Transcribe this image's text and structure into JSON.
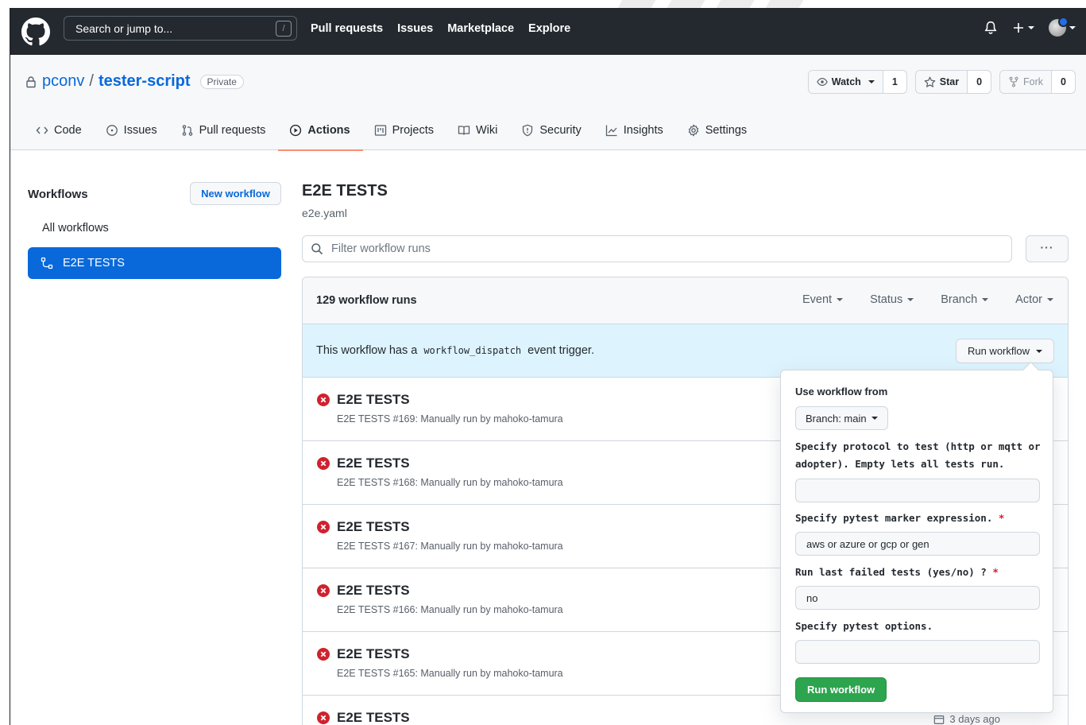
{
  "header": {
    "search_placeholder": "Search or jump to...",
    "slash_key": "/",
    "nav": [
      "Pull requests",
      "Issues",
      "Marketplace",
      "Explore"
    ]
  },
  "repo": {
    "owner": "pconv",
    "separator": "/",
    "name": "tester-script",
    "visibility": "Private",
    "watch_label": "Watch",
    "watch_count": "1",
    "star_label": "Star",
    "star_count": "0",
    "fork_label": "Fork",
    "fork_count": "0",
    "tabs": [
      {
        "label": "Code",
        "icon": "code-icon"
      },
      {
        "label": "Issues",
        "icon": "issue-icon"
      },
      {
        "label": "Pull requests",
        "icon": "pull-request-icon"
      },
      {
        "label": "Actions",
        "icon": "play-icon"
      },
      {
        "label": "Projects",
        "icon": "project-icon"
      },
      {
        "label": "Wiki",
        "icon": "book-icon"
      },
      {
        "label": "Security",
        "icon": "shield-icon"
      },
      {
        "label": "Insights",
        "icon": "graph-icon"
      },
      {
        "label": "Settings",
        "icon": "gear-icon"
      }
    ],
    "active_tab": "Actions"
  },
  "sidebar": {
    "title": "Workflows",
    "new_workflow": "New workflow",
    "all_workflows": "All workflows",
    "active_item": "E2E TESTS"
  },
  "main": {
    "title": "E2E TESTS",
    "file": "e2e.yaml",
    "filter_placeholder": "Filter workflow runs",
    "more": "···",
    "run_count": "129 workflow runs",
    "filters": [
      "Event",
      "Status",
      "Branch",
      "Actor"
    ],
    "dispatch_prefix": "This workflow has a",
    "dispatch_code": "workflow_dispatch",
    "dispatch_suffix": "event trigger.",
    "run_workflow_button": "Run workflow",
    "runs": [
      {
        "title": "E2E TESTS",
        "subtitle": "E2E TESTS #169: Manually run by mahoko-tamura",
        "status": "failed"
      },
      {
        "title": "E2E TESTS",
        "subtitle": "E2E TESTS #168: Manually run by mahoko-tamura",
        "status": "failed"
      },
      {
        "title": "E2E TESTS",
        "subtitle": "E2E TESTS #167: Manually run by mahoko-tamura",
        "status": "failed"
      },
      {
        "title": "E2E TESTS",
        "subtitle": "E2E TESTS #166: Manually run by mahoko-tamura",
        "status": "failed"
      },
      {
        "title": "E2E TESTS",
        "subtitle": "E2E TESTS #165: Manually run by mahoko-tamura",
        "status": "failed"
      },
      {
        "title": "E2E TESTS",
        "subtitle": "",
        "status": "failed",
        "time": "3 days ago"
      }
    ]
  },
  "popup": {
    "use_from": "Use workflow from",
    "branch": "Branch: main",
    "protocol_label": "Specify protocol to test (http or mqtt or adopter). Empty lets all tests run.",
    "protocol_value": "",
    "marker_label": "Specify pytest marker expression.",
    "marker_value": "aws or azure or gcp or gen",
    "lastfailed_label": "Run last failed tests (yes/no) ?",
    "lastfailed_value": "no",
    "options_label": "Specify pytest options.",
    "options_value": "",
    "required_mark": "*",
    "submit": "Run workflow"
  },
  "colors": {
    "header_bg": "#24292f",
    "accent": "#0969da",
    "failed": "#cf222e",
    "success_button": "#2da44e",
    "active_tab_underline": "#fd8c73",
    "dispatch_bg": "#ddf4ff"
  }
}
